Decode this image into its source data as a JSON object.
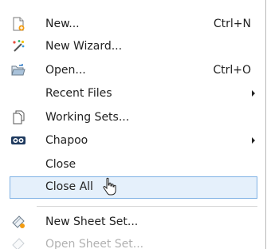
{
  "menu": {
    "items": [
      {
        "label": "New...",
        "shortcut": "Ctrl+N",
        "icon": "new-file-icon"
      },
      {
        "label": "New Wizard...",
        "icon": "wizard-wand-icon"
      },
      {
        "label": "Open...",
        "shortcut": "Ctrl+O",
        "icon": "open-folder-icon"
      },
      {
        "label": "Recent Files",
        "submenu": true
      },
      {
        "label": "Working Sets...",
        "icon": "working-sets-icon"
      },
      {
        "label": "Chapoo",
        "submenu": true,
        "icon": "chapoo-icon"
      },
      {
        "label": "Close"
      },
      {
        "label": "Close All",
        "highlighted": true
      },
      {
        "label": "New Sheet Set...",
        "icon": "new-sheet-set-icon"
      },
      {
        "label": "Open Sheet Set...",
        "icon": "open-sheet-set-icon"
      }
    ]
  },
  "colors": {
    "highlight_bg": "#e5f0fb",
    "highlight_border": "#7fb2e5",
    "text": "#222222",
    "separator": "#d6d6d6"
  }
}
